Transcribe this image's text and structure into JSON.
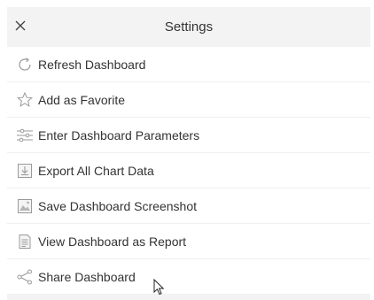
{
  "header": {
    "title": "Settings",
    "close_icon": "close-icon"
  },
  "menu": {
    "items": [
      {
        "label": "Refresh Dashboard",
        "icon": "refresh-icon"
      },
      {
        "label": "Add as Favorite",
        "icon": "star-icon"
      },
      {
        "label": "Enter Dashboard Parameters",
        "icon": "parameters-icon"
      },
      {
        "label": "Export All Chart Data",
        "icon": "export-icon"
      },
      {
        "label": "Save Dashboard Screenshot",
        "icon": "screenshot-icon"
      },
      {
        "label": "View Dashboard as Report",
        "icon": "report-icon"
      },
      {
        "label": "Share Dashboard",
        "icon": "share-icon"
      }
    ]
  },
  "colors": {
    "panel_bg": "#f3f3f3",
    "item_bg": "#ffffff",
    "text": "#333333",
    "icon": "#9a9a9a"
  }
}
